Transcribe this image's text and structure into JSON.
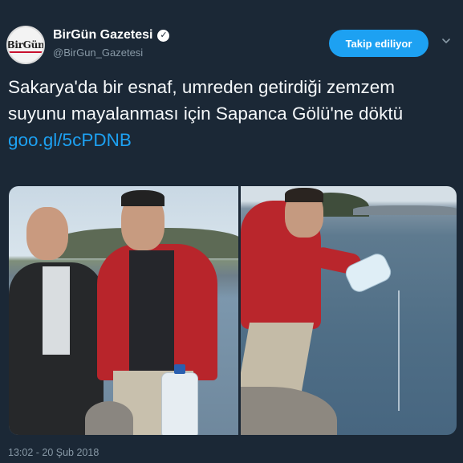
{
  "account": {
    "display_name": "BirGün Gazetesi",
    "handle": "@BirGun_Gazetesi",
    "avatar_text": "BirGün",
    "verified_icon": "verified-check-icon"
  },
  "follow_button": {
    "label": "Takip ediliyor"
  },
  "more_icon": "chevron-down-icon",
  "tweet": {
    "text": "Sakarya'da bir esnaf, umreden getirdiği zemzem suyunu mayalanması için Sapanca Gölü'ne döktü",
    "link": "goo.gl/5cPDNB"
  },
  "timestamp": "13:02 - 20 Şub 2018",
  "colors": {
    "background": "#1b2836",
    "accent": "#1da1f2",
    "secondary_text": "#8899a6"
  }
}
